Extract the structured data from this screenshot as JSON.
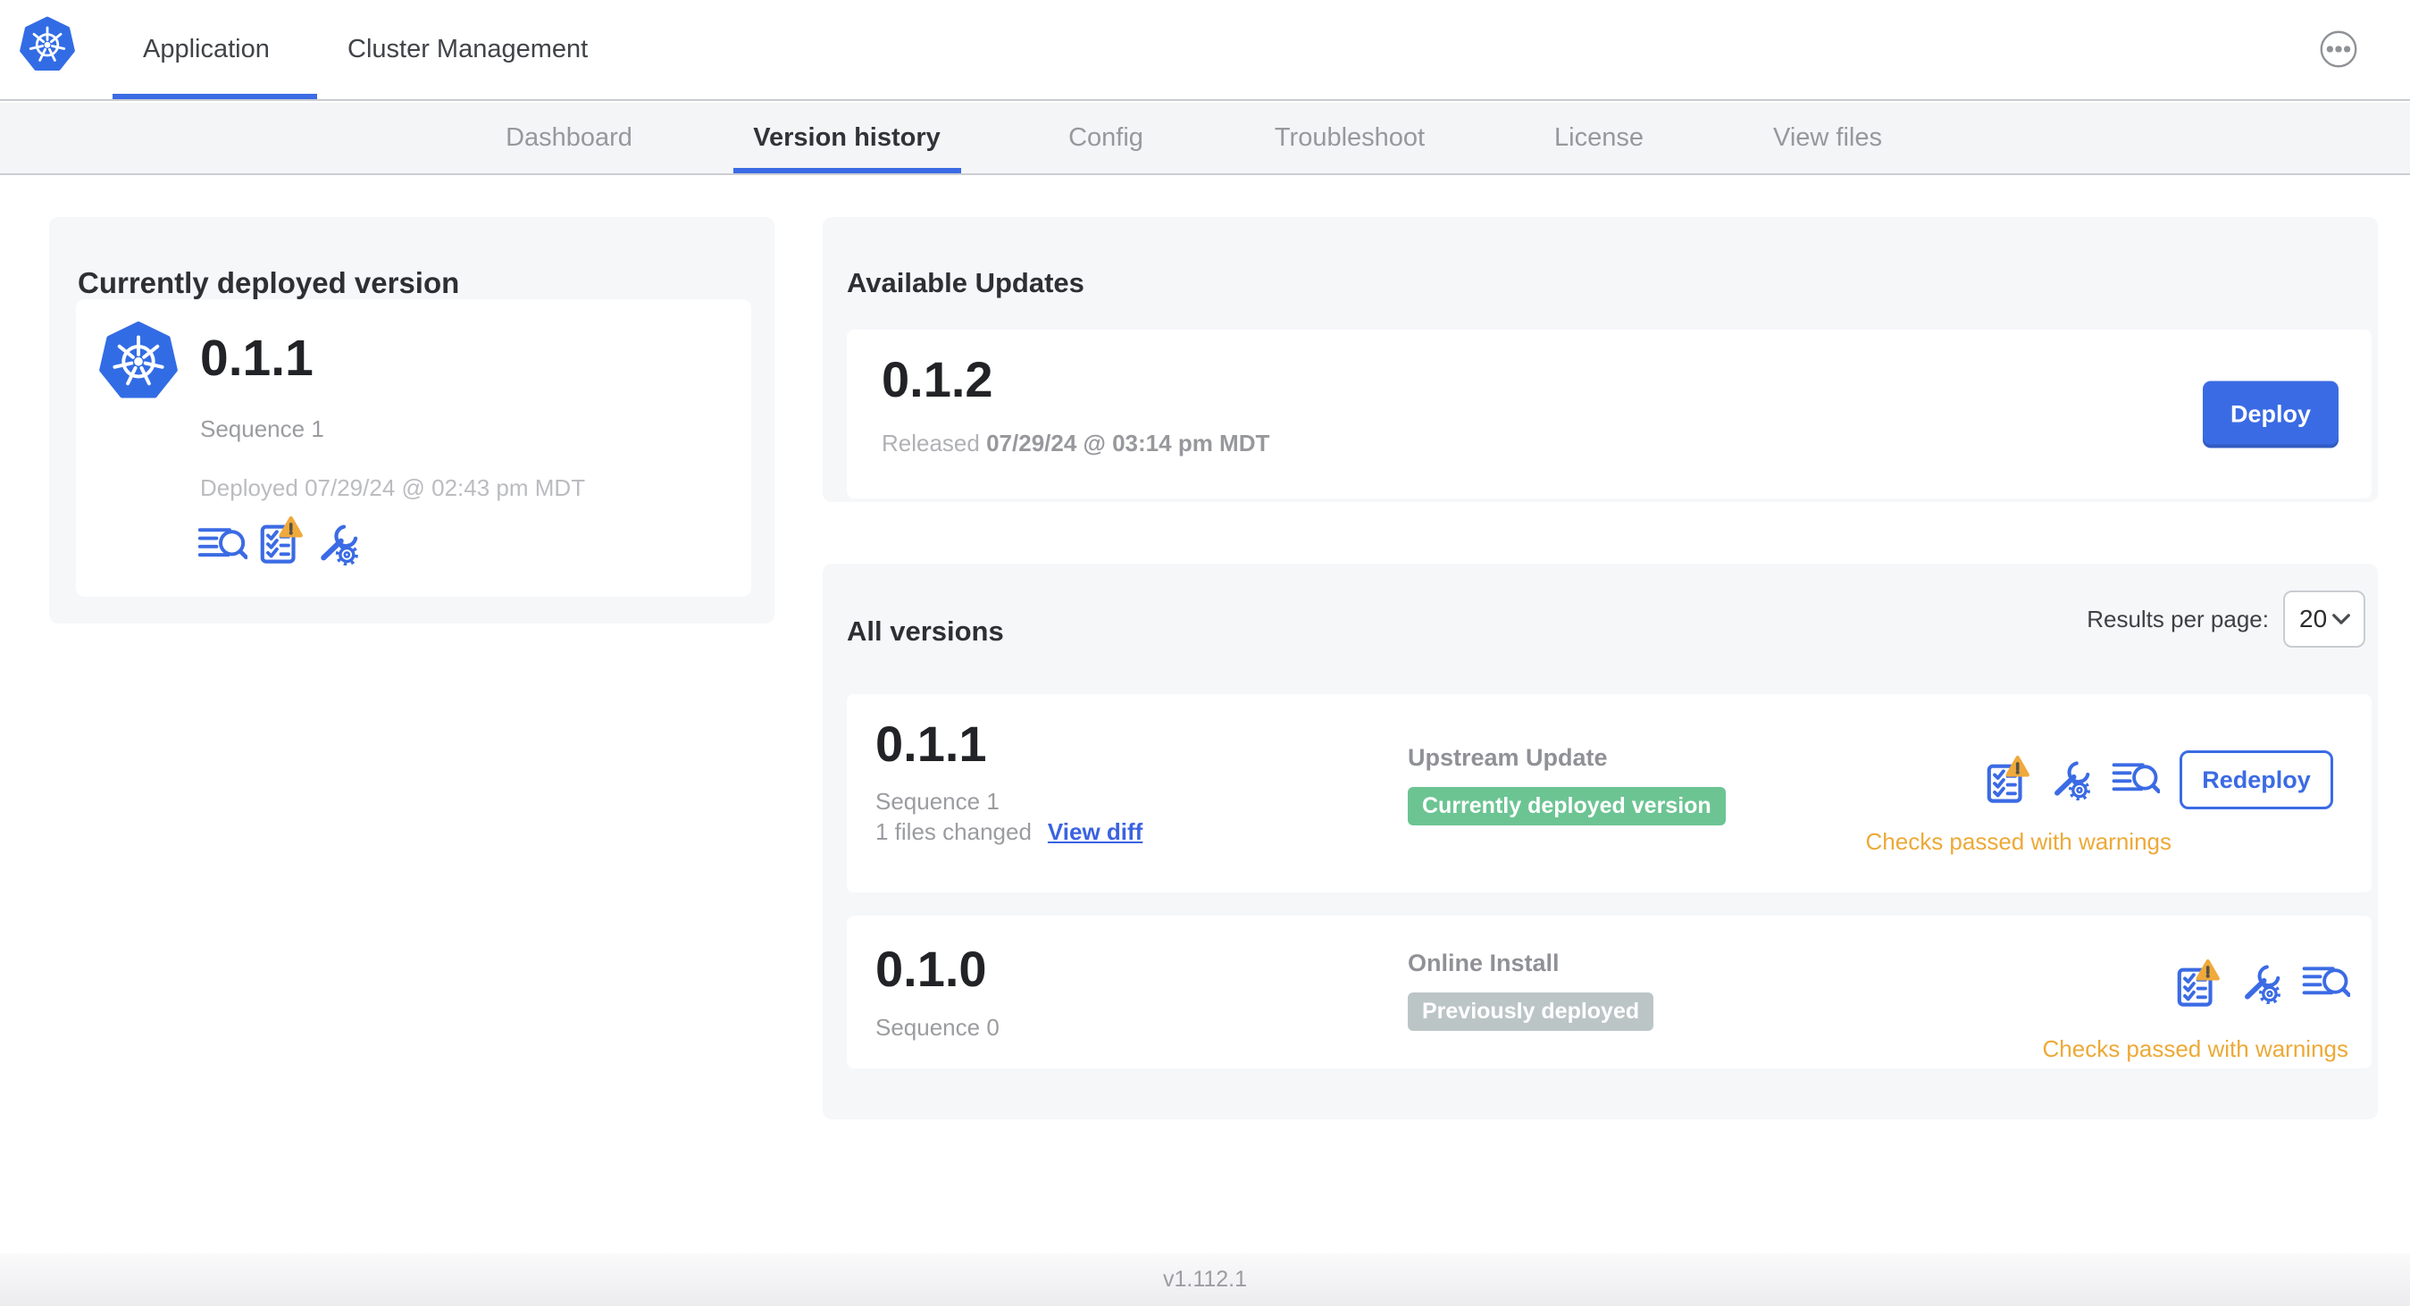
{
  "topnav": {
    "tabs": [
      {
        "label": "Application"
      },
      {
        "label": "Cluster Management"
      }
    ],
    "active_tab": "Application"
  },
  "subnav": {
    "tabs": [
      "Dashboard",
      "Version history",
      "Config",
      "Troubleshoot",
      "License",
      "View files"
    ],
    "active_tab": "Version history"
  },
  "current_card": {
    "title": "Currently deployed version",
    "version": "0.1.1",
    "sequence": "Sequence 1",
    "deployed": "Deployed 07/29/24 @ 02:43 pm MDT"
  },
  "available_updates": {
    "title": "Available Updates",
    "version": "0.1.2",
    "released_prefix": "Released",
    "released_date": "07/29/24 @ 03:14 pm MDT",
    "deploy_label": "Deploy"
  },
  "all_versions": {
    "title": "All versions",
    "results_per_page_label": "Results per page:",
    "results_per_page_value": "20",
    "rows": [
      {
        "version": "0.1.1",
        "sequence": "Sequence 1",
        "files_changed": "1 files changed",
        "view_diff_label": "View diff",
        "source": "Upstream Update",
        "badge_label": "Currently deployed version",
        "badge_color": "green",
        "action_label": "Redeploy",
        "status": "Checks passed with warnings"
      },
      {
        "version": "0.1.0",
        "sequence": "Sequence 0",
        "source": "Online Install",
        "badge_label": "Previously deployed",
        "badge_color": "gray",
        "status": "Checks passed with warnings"
      }
    ]
  },
  "footer": {
    "app_version": "v1.112.1"
  },
  "icons": {
    "logo": "kubernetes-helm-wheel",
    "menu": "ellipsis-circle",
    "release_notes": "lines-with-magnifier",
    "preflight_checks": "checklist-with-warning",
    "config": "wrench-with-gear",
    "dropdown": "chevron-down"
  },
  "colors": {
    "accent_blue": "#3b6be4",
    "k8s_blue": "#326ce5",
    "green_badge": "#6cc493",
    "gray_badge": "#bcc5c6",
    "warning_orange": "#eda937",
    "subnav_bg": "#f4f5f7",
    "card_bg": "#f6f7f9"
  }
}
